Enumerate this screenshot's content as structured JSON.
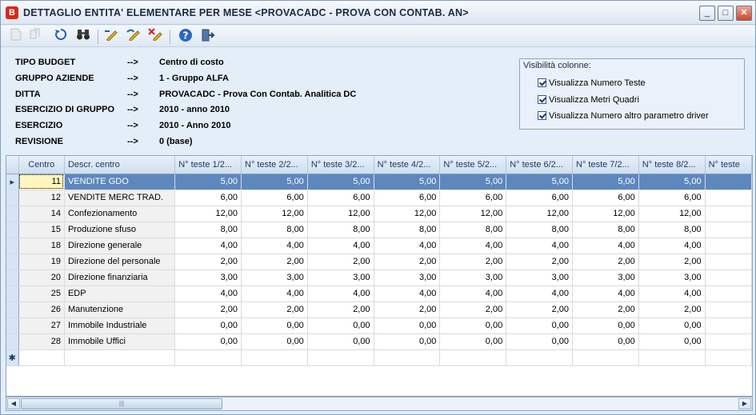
{
  "window": {
    "app_badge": "B",
    "title": "DETTAGLIO ENTITA' ELEMENTARE PER MESE <PROVACADC - PROVA CON CONTAB. AN>",
    "minimize": "_",
    "maximize": "□",
    "close": "✕"
  },
  "toolbar": {
    "icons": [
      "new-icon",
      "copy-icon",
      "refresh-icon",
      "binoculars-icon",
      "edit-icon",
      "undo-edit-icon",
      "delete-icon",
      "help-icon",
      "exit-icon"
    ]
  },
  "info": {
    "rows": [
      {
        "label": "TIPO BUDGET",
        "arrow": "-->",
        "value": "Centro di costo"
      },
      {
        "label": "GRUPPO AZIENDE",
        "arrow": "-->",
        "value": "1 - Gruppo ALFA"
      },
      {
        "label": "DITTA",
        "arrow": "-->",
        "value": "PROVACADC - Prova Con Contab. Analitica DC"
      },
      {
        "label": "ESERCIZIO DI GRUPPO",
        "arrow": "-->",
        "value": "2010 - anno 2010"
      },
      {
        "label": "ESERCIZIO",
        "arrow": "-->",
        "value": "2010 - Anno 2010"
      },
      {
        "label": "REVISIONE",
        "arrow": "-->",
        "value": "0 (base)"
      }
    ]
  },
  "column_visibility": {
    "title": "Visibilità colonne:",
    "options": [
      {
        "label": "Visualizza Numero Teste",
        "checked": true
      },
      {
        "label": "Visualizza Metri Quadri",
        "checked": true
      },
      {
        "label": "Visualizza Numero altro parametro driver",
        "checked": true
      }
    ]
  },
  "grid": {
    "columns": [
      "Centro",
      "Descr. centro",
      "N° teste 1/2...",
      "N° teste 2/2...",
      "N° teste 3/2...",
      "N° teste 4/2...",
      "N° teste 5/2...",
      "N° teste 6/2...",
      "N° teste 7/2...",
      "N° teste 8/2...",
      "N° teste"
    ],
    "rows": [
      {
        "marker": "▸",
        "centro": "11",
        "descr": "VENDITE GDO",
        "values": [
          "5,00",
          "5,00",
          "5,00",
          "5,00",
          "5,00",
          "5,00",
          "5,00",
          "5,00",
          ""
        ]
      },
      {
        "marker": "",
        "centro": "12",
        "descr": "VENDITE MERC TRAD.",
        "values": [
          "6,00",
          "6,00",
          "6,00",
          "6,00",
          "6,00",
          "6,00",
          "6,00",
          "6,00",
          ""
        ]
      },
      {
        "marker": "",
        "centro": "14",
        "descr": "Confezionamento",
        "values": [
          "12,00",
          "12,00",
          "12,00",
          "12,00",
          "12,00",
          "12,00",
          "12,00",
          "12,00",
          ""
        ]
      },
      {
        "marker": "",
        "centro": "15",
        "descr": "Produzione sfuso",
        "values": [
          "8,00",
          "8,00",
          "8,00",
          "8,00",
          "8,00",
          "8,00",
          "8,00",
          "8,00",
          ""
        ]
      },
      {
        "marker": "",
        "centro": "18",
        "descr": "Direzione generale",
        "values": [
          "4,00",
          "4,00",
          "4,00",
          "4,00",
          "4,00",
          "4,00",
          "4,00",
          "4,00",
          ""
        ]
      },
      {
        "marker": "",
        "centro": "19",
        "descr": "Direzione del personale",
        "values": [
          "2,00",
          "2,00",
          "2,00",
          "2,00",
          "2,00",
          "2,00",
          "2,00",
          "2,00",
          ""
        ]
      },
      {
        "marker": "",
        "centro": "20",
        "descr": "Direzione finanziaria",
        "values": [
          "3,00",
          "3,00",
          "3,00",
          "3,00",
          "3,00",
          "3,00",
          "3,00",
          "3,00",
          ""
        ]
      },
      {
        "marker": "",
        "centro": "25",
        "descr": "EDP",
        "values": [
          "4,00",
          "4,00",
          "4,00",
          "4,00",
          "4,00",
          "4,00",
          "4,00",
          "4,00",
          ""
        ]
      },
      {
        "marker": "",
        "centro": "26",
        "descr": "Manutenzione",
        "values": [
          "2,00",
          "2,00",
          "2,00",
          "2,00",
          "2,00",
          "2,00",
          "2,00",
          "2,00",
          ""
        ]
      },
      {
        "marker": "",
        "centro": "27",
        "descr": "Immobile Industriale",
        "values": [
          "0,00",
          "0,00",
          "0,00",
          "0,00",
          "0,00",
          "0,00",
          "0,00",
          "0,00",
          ""
        ]
      },
      {
        "marker": "",
        "centro": "28",
        "descr": "Immobile Uffici",
        "values": [
          "0,00",
          "0,00",
          "0,00",
          "0,00",
          "0,00",
          "0,00",
          "0,00",
          "0,00",
          ""
        ]
      }
    ],
    "new_row_marker": "✱"
  }
}
